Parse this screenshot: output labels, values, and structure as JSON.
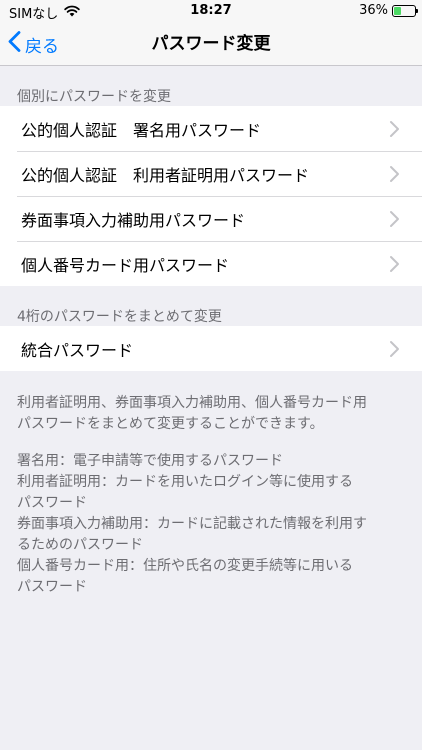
{
  "status_bar": {
    "carrier": "SIMなし",
    "time": "18:27",
    "battery_percent": "36%",
    "battery_level": 0.36
  },
  "nav": {
    "back_label": "戻る",
    "title": "パスワード変更"
  },
  "sections": [
    {
      "header": "個別にパスワードを変更",
      "items": [
        {
          "label": "公的個人認証　署名用パスワード"
        },
        {
          "label": "公的個人認証　利用者証明用パスワード"
        },
        {
          "label": "券面事項入力補助用パスワード"
        },
        {
          "label": "個人番号カード用パスワード"
        }
      ]
    },
    {
      "header": "4桁のパスワードをまとめて変更",
      "items": [
        {
          "label": "統合パスワード"
        }
      ]
    }
  ],
  "footer": {
    "description_lines": [
      "利用者証明用、券面事項入力補助用、個人番号カード用",
      "パスワードをまとめて変更することができます。"
    ],
    "notes_lines": [
      "署名用：電子申請等で使用するパスワード",
      "利用者証明用：カードを用いたログイン等に使用する",
      "パスワード",
      "券面事項入力補助用：カードに記載された情報を利用す",
      "るためのパスワード",
      "個人番号カード用：住所や氏名の変更手続等に用いる",
      "パスワード"
    ]
  },
  "colors": {
    "accent": "#007aff",
    "background": "#efeff4",
    "secondary_text": "#6d6d72",
    "battery": "#4cd964"
  }
}
